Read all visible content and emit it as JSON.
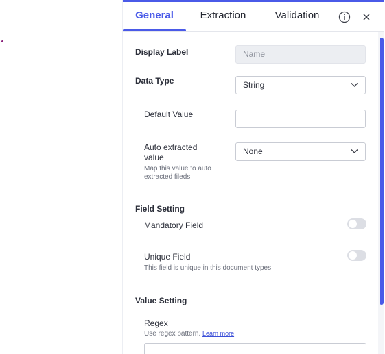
{
  "tabs": {
    "general": "General",
    "extraction": "Extraction",
    "validation": "Validation"
  },
  "form": {
    "display_label": {
      "label": "Display Label",
      "placeholder": "Name"
    },
    "data_type": {
      "label": "Data Type",
      "value": "String"
    },
    "default_value": {
      "label": "Default Value",
      "value": ""
    },
    "auto_extracted": {
      "label_line1": "Auto extracted",
      "label_line2": "value",
      "help_line1": "Map this value to auto",
      "help_line2": "extracted fileds",
      "value": "None"
    }
  },
  "field_setting": {
    "heading": "Field Setting",
    "mandatory": {
      "label": "Mandatory Field",
      "on": false
    },
    "unique": {
      "label": "Unique Field",
      "help": "This field is unique in this document types",
      "on": false
    }
  },
  "value_setting": {
    "heading": "Value Setting",
    "regex": {
      "label": "Regex",
      "help": "Use regex pattern.",
      "link": "Learn more",
      "value": ""
    }
  },
  "colors": {
    "accent": "#4a5ae8",
    "text": "#2c2f3a",
    "muted": "#6b6f7b"
  },
  "icons": {
    "info": "info-icon",
    "close": "close-icon",
    "chevron": "chevron-down-icon"
  }
}
